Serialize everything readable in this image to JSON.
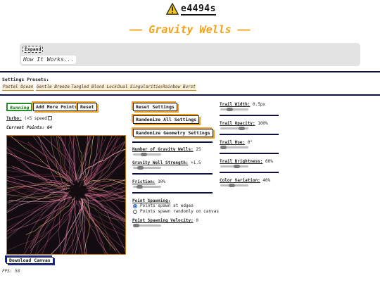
{
  "header": {
    "logo_text": "e4494s",
    "title": "—— Gravity Wells ——"
  },
  "info": {
    "expand_label": "Expand",
    "how_it_works": "How It Works..."
  },
  "presets": {
    "label": "Settings Presets:",
    "items": [
      "Pastel Ocean",
      "Gentle Breeze",
      "Tangled Blond Locks",
      "Dual Singularities",
      "Rainbow Burst"
    ]
  },
  "controls": {
    "running_label": "Running",
    "add_points_label": "Add More Points",
    "reset_label": "Reset",
    "turbo_label": "Turbo:",
    "turbo_desc": "(×5 speed)",
    "current_points_label": "Current Points:",
    "current_points_value": "64",
    "download_label": "Download Canvas"
  },
  "settings": {
    "reset_settings_label": "Reset Settings",
    "randomize_all_label": "Randomize All Settings",
    "randomize_geometry_label": "Randomize Geometry Settings",
    "num_wells_label": "Number of Gravity Wells:",
    "num_wells_value": "25",
    "num_wells_level": 0.35,
    "strength_label": "Gravity Well Strength:",
    "strength_value": "+1.5",
    "strength_level": 0.2,
    "friction_label": "Friction:",
    "friction_value": "10%",
    "friction_level": 0.15,
    "spawning_label": "Point Spawning:",
    "spawn_edges_label": "Points spawn at edges",
    "spawn_random_label": "Points spawn randomly on canvas",
    "spawn_velocity_label": "Point Spawning Velocity:",
    "spawn_velocity_value": "0",
    "spawn_velocity_level": 0.0
  },
  "trail": {
    "width_label": "Trail Width:",
    "width_value": "0.5px",
    "width_level": 0.3,
    "opacity_label": "Trail Opacity:",
    "opacity_value": "100%",
    "opacity_level": 0.85,
    "hue_label": "Trail Hue:",
    "hue_value": "0°",
    "hue_level": 0.0,
    "brightness_label": "Trail Brightness:",
    "brightness_value": "60%",
    "brightness_level": 0.6,
    "variation_label": "Color Variation:",
    "variation_value": "40%",
    "variation_level": 0.4
  },
  "status": {
    "fps_label": "FPS:",
    "fps_value": "58"
  },
  "colors": {
    "accent": "#f0a020",
    "title": "#f2a31a",
    "running": "#2a8a2a",
    "rule": "#101040"
  }
}
